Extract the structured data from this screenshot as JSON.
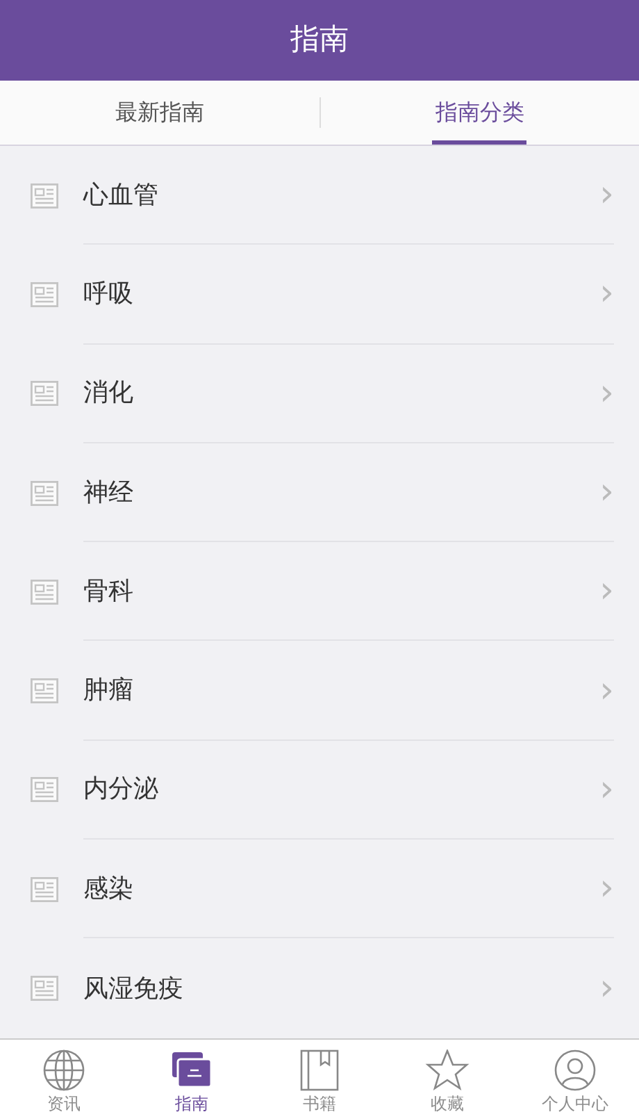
{
  "header": {
    "title": "指南"
  },
  "tabs": [
    {
      "label": "最新指南",
      "selected": false
    },
    {
      "label": "指南分类",
      "selected": true
    }
  ],
  "categories": [
    {
      "label": "心血管",
      "chevron": "›"
    },
    {
      "label": "呼吸",
      "chevron": "›"
    },
    {
      "label": "消化",
      "chevron": "›"
    },
    {
      "label": "神经",
      "chevron": "›"
    },
    {
      "label": "骨科",
      "chevron": "›"
    },
    {
      "label": "肿瘤",
      "chevron": "›"
    },
    {
      "label": "内分泌",
      "chevron": "›"
    },
    {
      "label": "感染",
      "chevron": "›"
    },
    {
      "label": "风湿免疫",
      "chevron": "›"
    }
  ],
  "bottom_nav": [
    {
      "label": "资讯",
      "kind": "globe",
      "selected": false
    },
    {
      "label": "指南",
      "kind": "cards",
      "selected": true
    },
    {
      "label": "书籍",
      "kind": "book",
      "selected": false
    },
    {
      "label": "收藏",
      "kind": "star",
      "selected": false
    },
    {
      "label": "个人中心",
      "kind": "person",
      "selected": false
    }
  ]
}
